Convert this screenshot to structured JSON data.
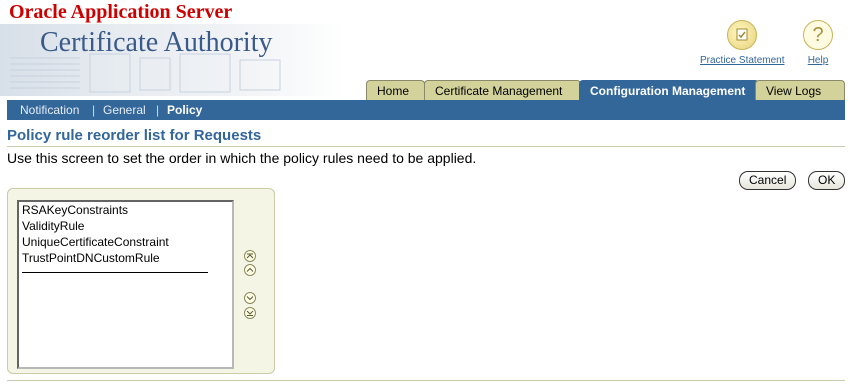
{
  "brand": {
    "vendor": "Oracle Application Server",
    "product": "Certificate Authority"
  },
  "global_links": {
    "practice_statement": "Practice Statement",
    "help": "Help"
  },
  "tabs": [
    {
      "label": "Home",
      "active": false
    },
    {
      "label": "Certificate Management",
      "active": false
    },
    {
      "label": "Configuration Management",
      "active": true
    },
    {
      "label": "View Logs",
      "active": false
    }
  ],
  "subnav": [
    {
      "label": "Notification",
      "active": false
    },
    {
      "label": "General",
      "active": false
    },
    {
      "label": "Policy",
      "active": true
    }
  ],
  "page": {
    "title": "Policy rule reorder list for Requests",
    "instructions": "Use this screen to set the order in which the policy rules need to be applied."
  },
  "buttons": {
    "cancel": "Cancel",
    "ok": "OK"
  },
  "rules": [
    "RSAKeyConstraints",
    "ValidityRule",
    "UniqueCertificateConstraint",
    "TrustPointDNCustomRule"
  ],
  "reorder_controls": [
    "move-to-top-icon",
    "move-up-icon",
    "move-down-icon",
    "move-to-bottom-icon"
  ],
  "colors": {
    "brand_red": "#cc0000",
    "nav_blue": "#336699",
    "tab_inactive": "#d2d29a"
  }
}
